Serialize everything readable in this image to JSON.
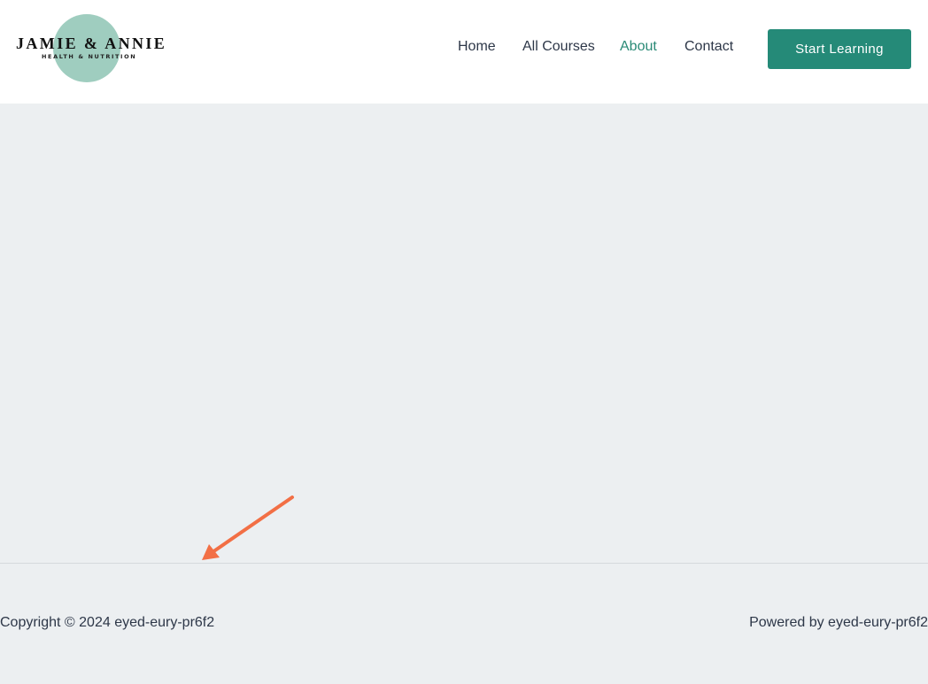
{
  "brand": {
    "name": "JAMIE & ANNIE",
    "tagline": "HEALTH & NUTRITION",
    "blob_color": "#9fcdbf"
  },
  "nav": {
    "items": [
      {
        "label": "Home",
        "active": false
      },
      {
        "label": "All Courses",
        "active": false
      },
      {
        "label": "About",
        "active": true
      },
      {
        "label": "Contact",
        "active": false
      }
    ],
    "active_color": "#2a8a76"
  },
  "header": {
    "cta_label": "Start Learning",
    "cta_color": "#258a78"
  },
  "annotation": {
    "icon": "arrow-icon",
    "color": "#f26f45"
  },
  "footer": {
    "copyright": "Copyright © 2024 eyed-eury-pr6f2",
    "powered_by": "Powered by eyed-eury-pr6f2"
  }
}
